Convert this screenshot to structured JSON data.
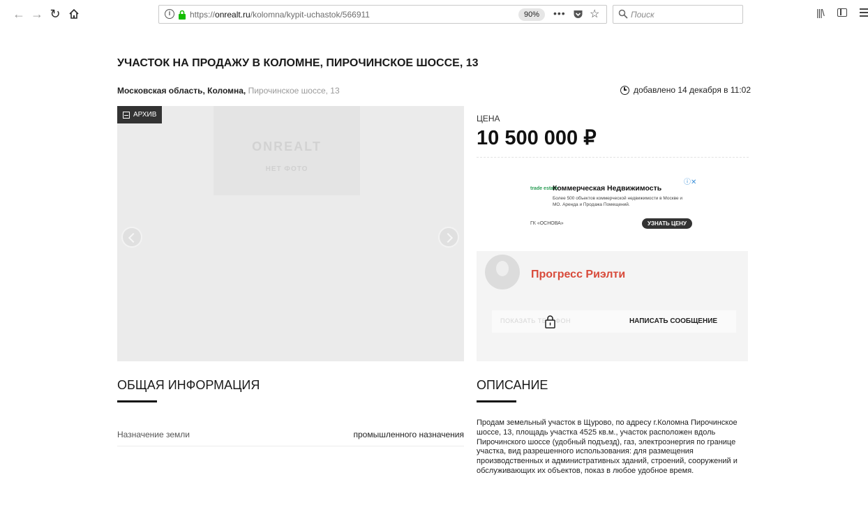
{
  "browser": {
    "url_prefix": "https://",
    "url_domain": "onrealt.ru",
    "url_path": "/kolomna/kypit-uchastok/566911",
    "zoom": "90%",
    "search_placeholder": "Поиск"
  },
  "listing": {
    "title": "УЧАСТОК НА ПРОДАЖУ В КОЛОМНЕ, ПИРОЧИНСКОЕ ШОССЕ, 13",
    "location_region": "Московская область, Коломна,",
    "location_street": "Пирочинское шоссе, 13",
    "added": "добавлено 14 декабря в 11:02",
    "archive_label": "АРХИВ",
    "placeholder_logo": "ONREALT",
    "placeholder_text": "НЕТ ФОТО",
    "price_label": "ЦЕНА",
    "price": "10 500 000 ₽"
  },
  "ad": {
    "logo": "trade estate",
    "title": "Коммерческая Недвижимость",
    "text": "Более 500 объектов коммерческой недвижимости в Москве и МО. Аренда и Продажа Помещений.",
    "brand": "ГК «ОСНОВА»",
    "cta": "УЗНАТЬ ЦЕНУ"
  },
  "agent": {
    "name": "Прогресс Риэлти",
    "phone_label": "ПОКАЗАТЬ ТЕЛЕФОН",
    "message_label": "НАПИСАТЬ СООБЩЕНИЕ"
  },
  "info": {
    "title": "ОБЩАЯ ИНФОРМАЦИЯ",
    "rows": [
      {
        "key": "Назначение земли",
        "value": "промышленного назначения"
      }
    ]
  },
  "description": {
    "title": "ОПИСАНИЕ",
    "text": "Продам земельный участок в Щурово, по адресу г.Коломна Пирочинское шоссе, 13, площадь участка 4525 кв.м., участок расположен вдоль Пирочинского шоссе (удобный подъезд), газ, электроэнергия по границе участка, вид разрешенного использования: для размещения производственных и административных зданий, строений, сооружений и обслуживающих их объектов, показ в любое удобное время."
  }
}
